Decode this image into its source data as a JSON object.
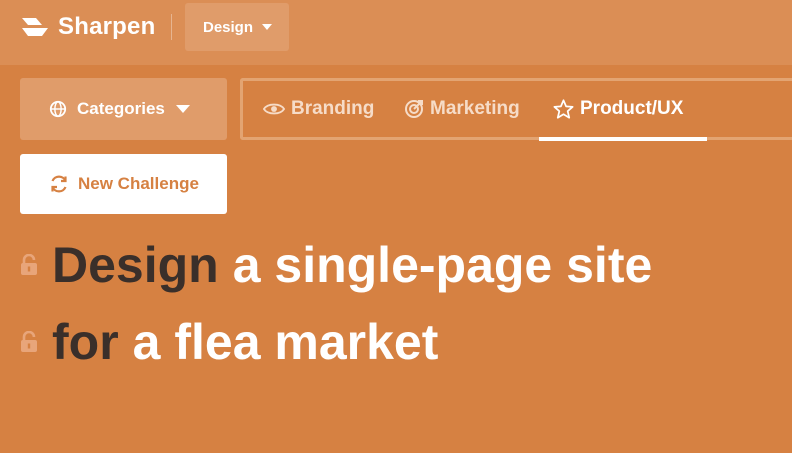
{
  "header": {
    "app_name": "Sharpen",
    "section_dropdown": "Design"
  },
  "filters": {
    "categories_label": "Categories",
    "tabs": [
      {
        "label": "Branding",
        "icon": "eye-icon",
        "active": false
      },
      {
        "label": "Marketing",
        "icon": "target-icon",
        "active": false
      },
      {
        "label": "Product/UX",
        "icon": "star-icon",
        "active": true
      }
    ]
  },
  "actions": {
    "new_challenge_label": "New Challenge"
  },
  "challenge": {
    "line1": {
      "keyword": "Design",
      "rest": "a single-page site"
    },
    "line2": {
      "keyword": "for",
      "rest": "a flea market"
    }
  },
  "colors": {
    "background": "#d68142",
    "topbar": "#db8e55",
    "panel": "#e09c6a",
    "accent_text": "#d68142",
    "keyword_text": "#3a2f2a",
    "white": "#ffffff"
  }
}
